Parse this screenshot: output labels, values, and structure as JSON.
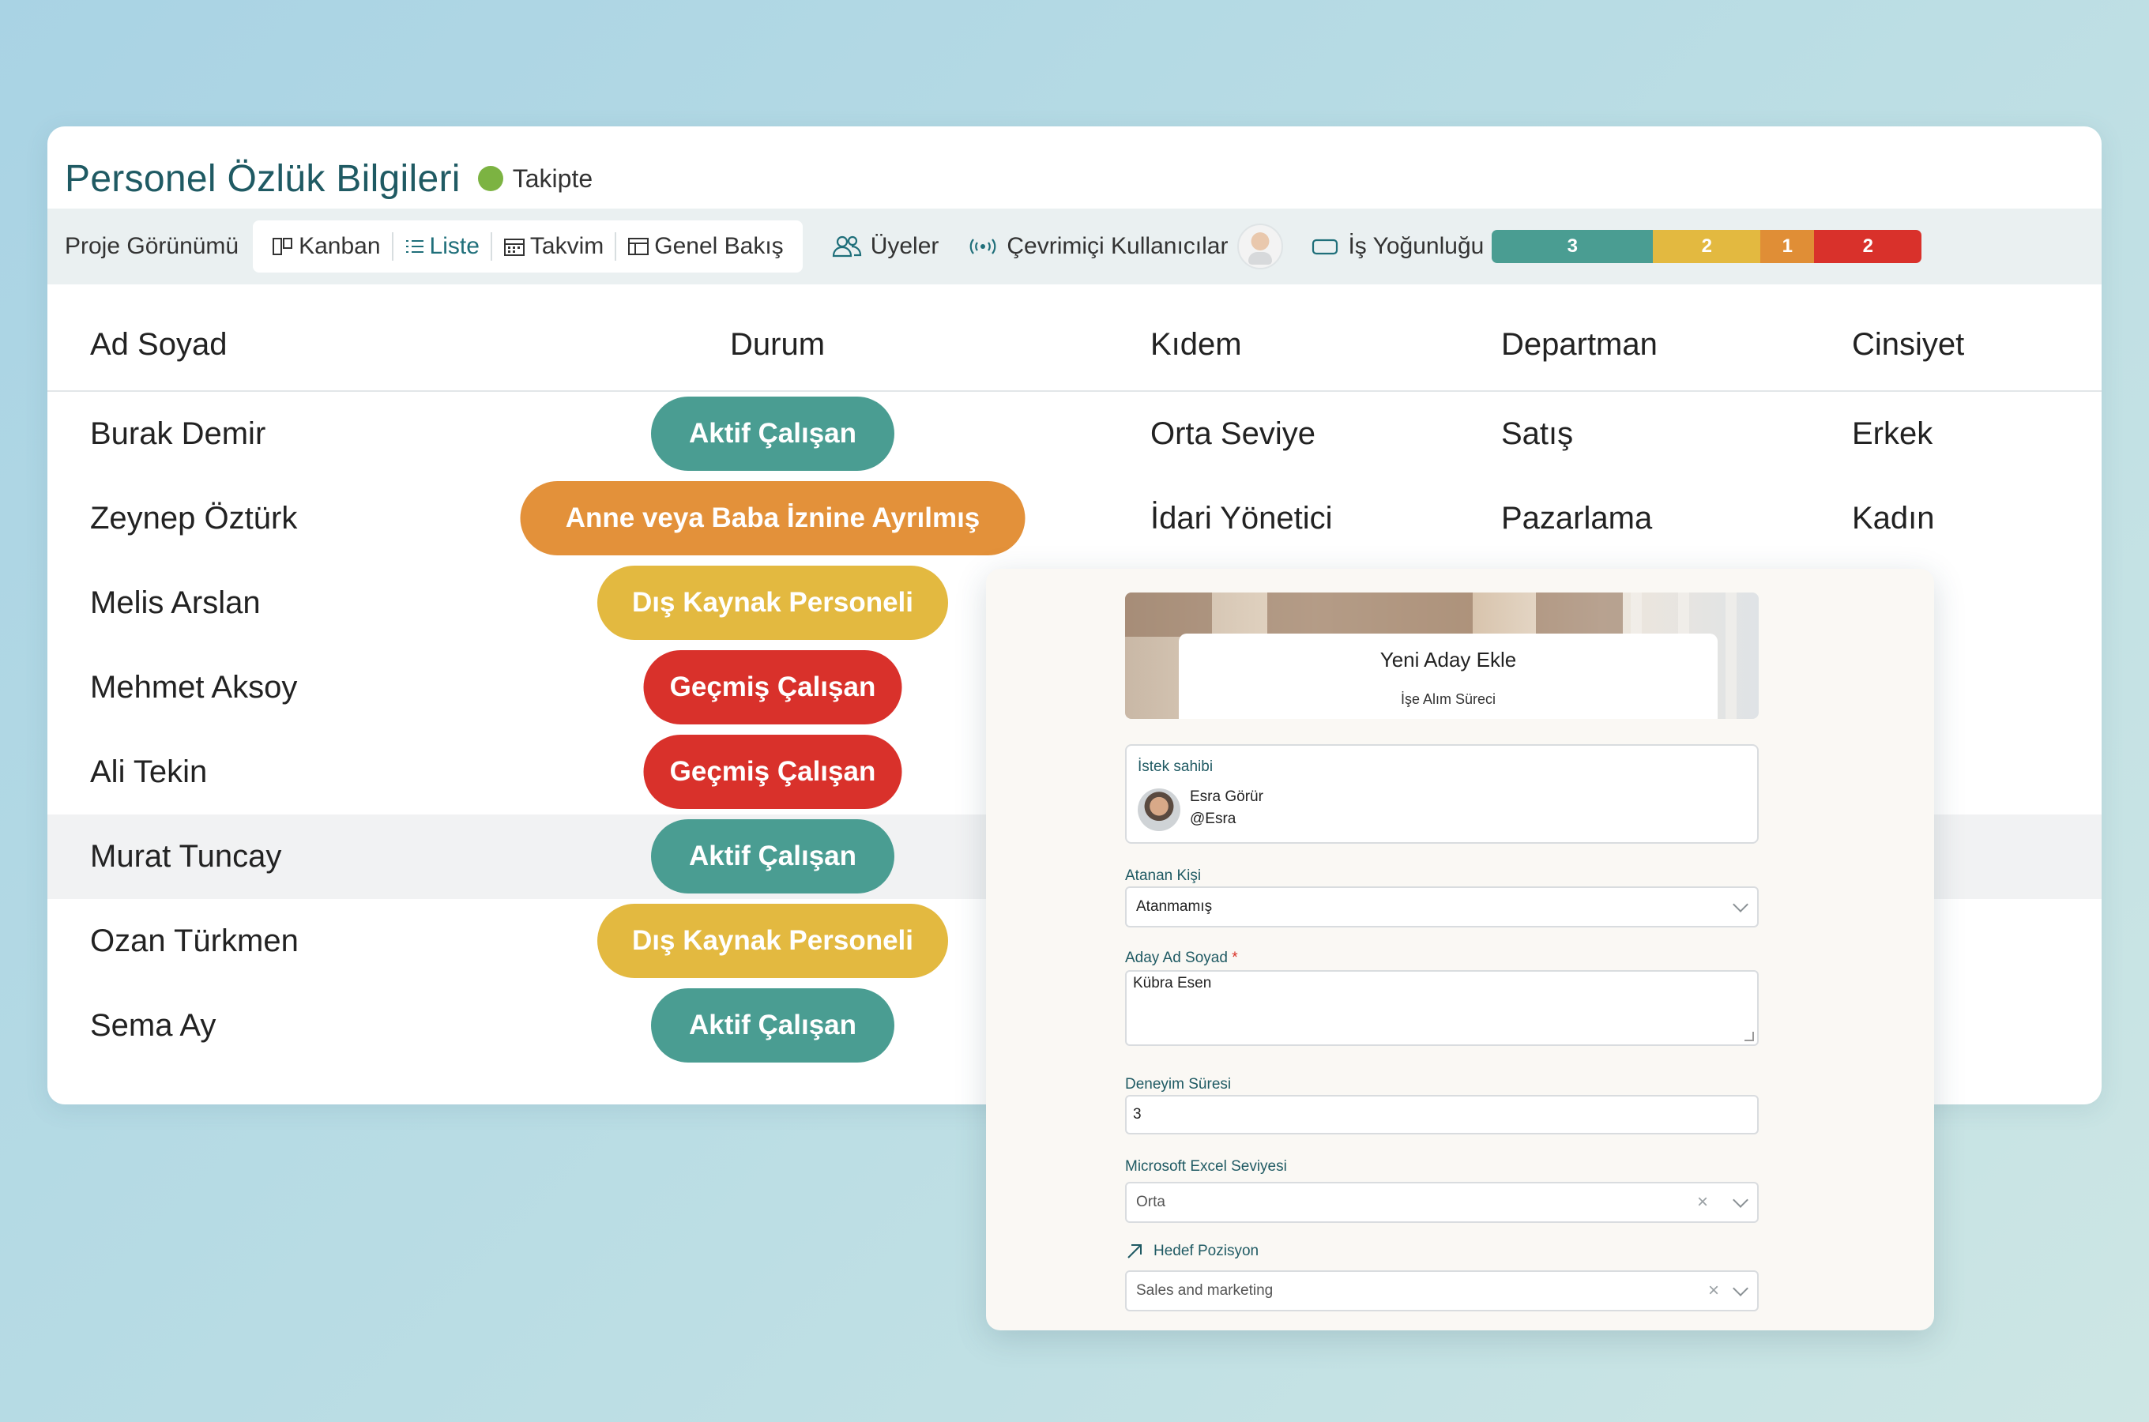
{
  "header": {
    "title": "Personel Özlük Bilgileri",
    "status_label": "Takipte",
    "status_color": "#7cb342"
  },
  "toolbar": {
    "view_label": "Proje Görünümü",
    "views": [
      {
        "label": "Kanban",
        "icon": "kanban-icon"
      },
      {
        "label": "Liste",
        "icon": "list-icon",
        "active": true
      },
      {
        "label": "Takvim",
        "icon": "calendar-icon"
      },
      {
        "label": "Genel Bakış",
        "icon": "overview-icon"
      }
    ],
    "members_label": "Üyeler",
    "online_users_label": "Çevrimiçi Kullanıcılar",
    "workload_label": "İş Yoğunluğu",
    "workload": [
      {
        "value": "3",
        "color": "#4a9d92"
      },
      {
        "value": "2",
        "color": "#e3b940"
      },
      {
        "value": "1",
        "color": "#e08e36"
      },
      {
        "value": "2",
        "color": "#d9312b"
      }
    ]
  },
  "table": {
    "columns": [
      "Ad Soyad",
      "Durum",
      "Kıdem",
      "Departman",
      "Cinsiyet"
    ],
    "rows": [
      {
        "name": "Burak Demir",
        "status": "Aktif Çalışan",
        "status_color": "#4a9d92",
        "seniority": "Orta Seviye",
        "department": "Satış",
        "gender": "Erkek"
      },
      {
        "name": "Zeynep Öztürk",
        "status": "Anne veya Baba İznine Ayrılmış",
        "status_color": "#e3913a",
        "seniority": "İdari Yönetici",
        "department": "Pazarlama",
        "gender": "Kadın"
      },
      {
        "name": "Melis Arslan",
        "status": "Dış Kaynak Personeli",
        "status_color": "#e3b940"
      },
      {
        "name": "Mehmet Aksoy",
        "status": "Geçmiş Çalışan",
        "status_color": "#d9312b"
      },
      {
        "name": "Ali Tekin",
        "status": "Geçmiş Çalışan",
        "status_color": "#d9312b"
      },
      {
        "name": "Murat Tuncay",
        "status": "Aktif Çalışan",
        "status_color": "#4a9d92"
      },
      {
        "name": "Ozan Türkmen",
        "status": "Dış Kaynak Personeli",
        "status_color": "#e3b940"
      },
      {
        "name": "Sema Ay",
        "status": "Aktif Çalışan",
        "status_color": "#4a9d92"
      }
    ]
  },
  "form": {
    "title": "Yeni Aday Ekle",
    "subtitle": "İşe Alım Süreci",
    "requester": {
      "label": "İstek sahibi",
      "name": "Esra Görür",
      "handle": "@Esra"
    },
    "assignee": {
      "label": "Atanan Kişi",
      "value": "Atanmamış"
    },
    "candidate_name": {
      "label": "Aday Ad Soyad",
      "required_mark": "*",
      "value": "Kübra Esen"
    },
    "experience": {
      "label": "Deneyim Süresi",
      "value": "3"
    },
    "excel_level": {
      "label": "Microsoft Excel Seviyesi",
      "value": "Orta"
    },
    "target_position": {
      "label": "Hedef Pozisyon",
      "value": "Sales and marketing"
    }
  }
}
